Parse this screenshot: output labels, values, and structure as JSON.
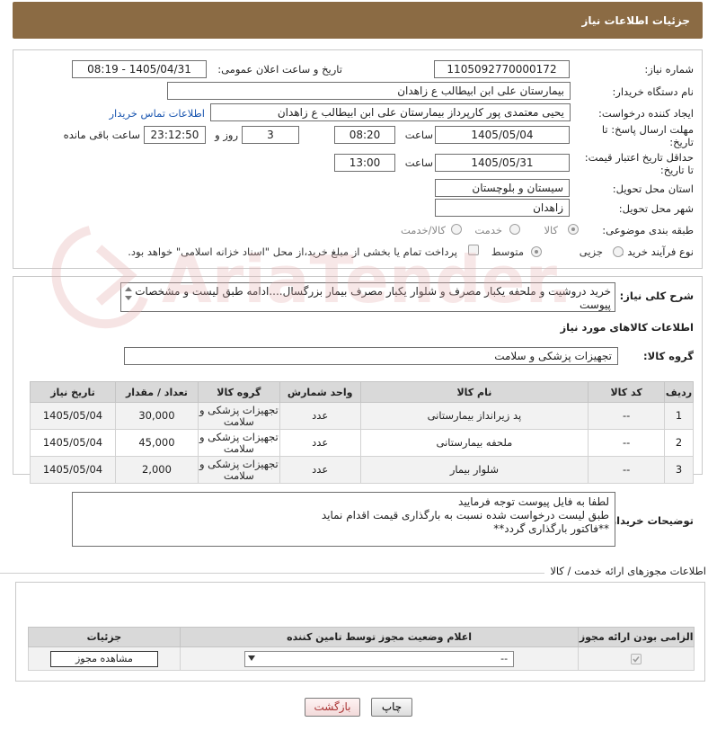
{
  "header": {
    "title": "جزئیات اطلاعات نیاز"
  },
  "form": {
    "need_number_label": "شماره نیاز:",
    "need_number": "1105092770000172",
    "announce_label": "تاریخ و ساعت اعلان عمومی:",
    "announce_value": "1405/04/31 - 08:19",
    "buyer_label": "نام دستگاه خریدار:",
    "buyer_value": "بیمارستان علی ابن ابیطالب  ع  زاهدان",
    "creator_label": "ایجاد کننده درخواست:",
    "creator_value": "یحیی معتمدی پور کارپرداز بیمارستان علی ابن ابیطالب  ع  زاهدان",
    "contact_link": "اطلاعات تماس خریدار",
    "deadline_label_1": "مهلت ارسال پاسخ: تا",
    "deadline_label_2": "تاریخ:",
    "deadline_date": "1405/05/04",
    "time_label": "ساعت",
    "deadline_time": "08:20",
    "days_value": "3",
    "days_label": "روز و",
    "remaining_time": "23:12:50",
    "remaining_label": "ساعت باقی مانده",
    "validity_label_1": "حداقل تاریخ اعتبار قیمت:",
    "validity_label_2": "تا تاریخ:",
    "validity_date": "1405/05/31",
    "validity_time": "13:00",
    "province_label": "استان محل تحویل:",
    "province_value": "سیستان و بلوچستان",
    "city_label": "شهر محل تحویل:",
    "city_value": "زاهدان",
    "category_label": "طبقه بندی موضوعی:",
    "category_options": [
      "کالا",
      "خدمت",
      "کالا/خدمت"
    ],
    "process_label": "نوع فرآیند خرید :",
    "process_options": [
      "جزیی",
      "متوسط"
    ],
    "payment_note": "پرداخت تمام یا بخشی از مبلغ خرید،از محل \"اسناد خزانه اسلامی\" خواهد بود."
  },
  "description": {
    "label": "شرح کلی نیاز:",
    "text": "خرید دروشیت و ملحفه یکبار مصرف و شلوار یکبار مصرف بیمار بزرگسال....ادامه طبق لیست و مشخصات پیوست",
    "goods_info_title": "اطلاعات کالاهای مورد نیاز",
    "goods_group_label": "گروه کالا:",
    "goods_group_value": "تجهیزات پزشکی و سلامت"
  },
  "goods_table": {
    "headers": [
      "ردیف",
      "کد کالا",
      "نام کالا",
      "واحد شمارش",
      "گروه کالا",
      "تعداد / مقدار",
      "تاریخ نیاز"
    ],
    "rows": [
      {
        "idx": "1",
        "code": "--",
        "name": "پد زیرانداز بیمارستانی",
        "unit": "عدد",
        "group": "تجهیزات پزشکی و سلامت",
        "qty": "30,000",
        "date": "1405/05/04"
      },
      {
        "idx": "2",
        "code": "--",
        "name": "ملحفه بیمارستانی",
        "unit": "عدد",
        "group": "تجهیزات پزشکی و سلامت",
        "qty": "45,000",
        "date": "1405/05/04"
      },
      {
        "idx": "3",
        "code": "--",
        "name": "شلوار بیمار",
        "unit": "عدد",
        "group": "تجهیزات پزشکی و سلامت",
        "qty": "2,000",
        "date": "1405/05/04"
      }
    ]
  },
  "buyer_notes": {
    "label": "توضیحات خریدار:",
    "line1": "لطفا به فایل پیوست توجه فرمایید",
    "line2": "طبق لیست درخواست شده نسبت به بارگذاری قیمت اقدام نماید",
    "line3": "**فاکتور بارگذاری گردد**"
  },
  "permits": {
    "section_title": "اطلاعات مجوزهای ارائه خدمت / کالا",
    "headers": [
      "الزامی بودن ارائه مجوز",
      "اعلام وضعیت مجوز توسط تامین کننده",
      "جزئیات"
    ],
    "select_value": "--",
    "view_button": "مشاهده مجوز"
  },
  "actions": {
    "print": "چاپ",
    "back": "بازگشت"
  },
  "watermark": {
    "text": "AriaTender.net"
  }
}
